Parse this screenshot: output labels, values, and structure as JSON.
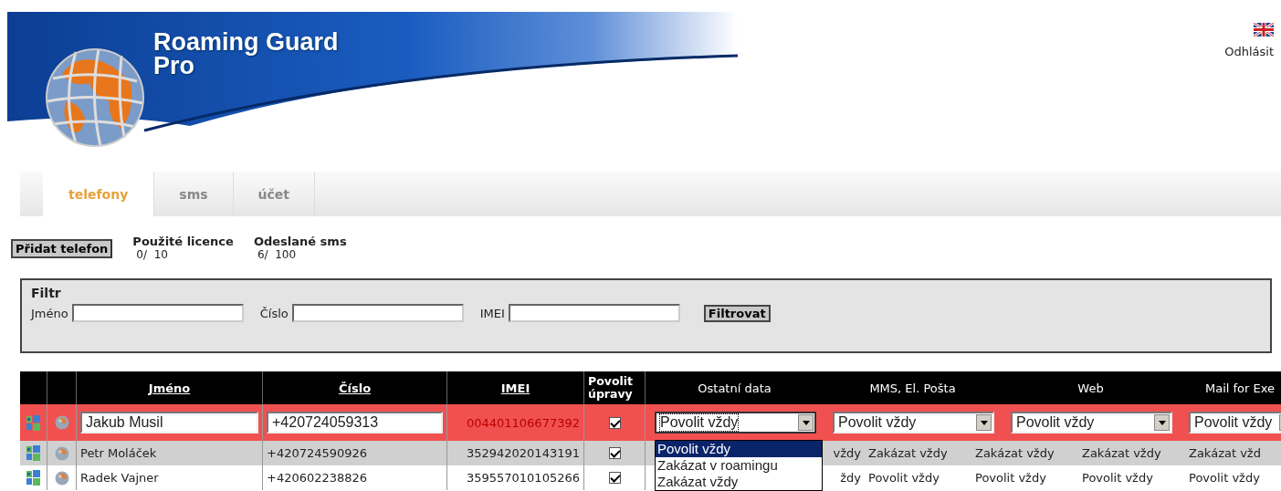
{
  "header": {
    "logo_lines": [
      "Roaming Guard",
      "Pro"
    ],
    "logout": "Odhlásit"
  },
  "tabs": [
    {
      "label": "telefony",
      "selected": true
    },
    {
      "label": "sms",
      "selected": false
    },
    {
      "label": "účet",
      "selected": false
    }
  ],
  "toolbar": {
    "add_button": "Přidat telefon",
    "stats": [
      {
        "label": "Použité licence",
        "value": "0/  10"
      },
      {
        "label": "Odeslané sms",
        "value": "6/  100"
      }
    ]
  },
  "filter": {
    "title": "Filtr",
    "fields": [
      {
        "label": "Jméno"
      },
      {
        "label": "Číslo"
      },
      {
        "label": "IMEI"
      }
    ],
    "button": "Filtrovat"
  },
  "table": {
    "columns": [
      {
        "label": "Jméno",
        "kind": "sort"
      },
      {
        "label": "Číslo",
        "kind": "sort"
      },
      {
        "label": "IMEI",
        "kind": "sort"
      },
      {
        "label": "Povolit úpravy",
        "kind": "flag"
      },
      {
        "label": "Ostatní data",
        "kind": "setting"
      },
      {
        "label": "MMS, El. Pošta",
        "kind": "setting"
      },
      {
        "label": "Web",
        "kind": "setting"
      },
      {
        "label": "Mail for Exe",
        "kind": "setting"
      }
    ],
    "rows": [
      {
        "kind": "edit",
        "selected": true,
        "name": "Jakub Musil",
        "number": "+420724059313",
        "imei": "004401106677392",
        "allow_edit": true,
        "settings": [
          {
            "value": "Povolit vždy",
            "expanded": true,
            "options": [
              {
                "label": "Povolit vždy",
                "selected": true
              },
              {
                "label": "Zakázat v roamingu",
                "selected": false
              },
              {
                "label": "Zakázat vždy",
                "selected": false
              }
            ]
          },
          {
            "value": "Povolit vždy",
            "expanded": false
          },
          {
            "value": "Povolit vždy",
            "expanded": false
          },
          {
            "value": "Povolit vždy",
            "expanded": false
          }
        ]
      },
      {
        "kind": "view",
        "selected": false,
        "name": "Petr Moláček",
        "number": "+420724590926",
        "imei": "352942020143191",
        "allow_edit": true,
        "settings": [
          {
            "value": "vždy"
          },
          {
            "value": "Zakázat vždy"
          },
          {
            "value": "Zakázat vždy"
          },
          {
            "value": "Zakázat vždy"
          },
          {
            "value": "Zakázat vžd"
          }
        ]
      },
      {
        "kind": "view",
        "selected": false,
        "name": "Radek Vajner",
        "number": "+420602238826",
        "imei": "359557010105266",
        "allow_edit": true,
        "settings": [
          {
            "value": "ždy"
          },
          {
            "value": "Povolit vždy"
          },
          {
            "value": "Povolit vždy"
          },
          {
            "value": "Povolit vždy"
          },
          {
            "value": "Povolit vždy"
          }
        ]
      }
    ]
  }
}
